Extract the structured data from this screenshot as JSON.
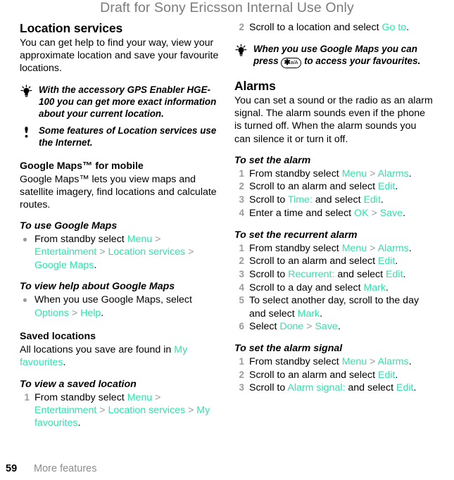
{
  "header": {
    "draft_notice": "Draft for Sony Ericsson Internal Use Only"
  },
  "colors": {
    "ui_accent": "#2ee3ac",
    "muted": "#9a9a9a",
    "draft_gray": "#7b7b7b"
  },
  "left_column": {
    "location_services": {
      "title": "Location services",
      "body": "You can get help to find your way, view your approximate location and save your favourite locations."
    },
    "tip_gps": {
      "icon": "lightbulb-icon",
      "text": "With the accessory GPS Enabler HGE-100 you can get more exact information about your current location."
    },
    "note_internet": {
      "icon": "exclamation-icon",
      "text": "Some features of Location services use the Internet."
    },
    "google_maps": {
      "title": "Google Maps™ for mobile",
      "body": "Google Maps™ lets you view maps and satellite imagery, find locations and calculate routes."
    },
    "to_use_google_maps": {
      "title": "To use Google Maps",
      "bullets": [
        {
          "pre": "From standby select ",
          "parts": [
            "Menu",
            "Entertainment",
            "Location services",
            "Google Maps"
          ],
          "post": "."
        }
      ]
    },
    "to_view_help": {
      "title": "To view help about Google Maps",
      "bullets": [
        {
          "pre": "When you use Google Maps, select ",
          "parts": [
            "Options",
            "Help"
          ],
          "post": "."
        }
      ]
    },
    "saved_locations": {
      "title": "Saved locations",
      "body_pre": "All locations you save are found in ",
      "body_ui": "My favourites",
      "body_post": "."
    },
    "to_view_saved_location": {
      "title": "To view a saved location",
      "steps": [
        {
          "num": "1",
          "pre": "From standby select ",
          "parts": [
            "Menu",
            "Entertainment",
            "Location services",
            "My favourites"
          ],
          "post": "."
        }
      ]
    }
  },
  "right_column": {
    "continued_step": {
      "num": "2",
      "pre": "Scroll to a location and select ",
      "ui": "Go to",
      "post": "."
    },
    "tip_favourites": {
      "icon": "lightbulb-icon",
      "pre": "When you use Google Maps you can press ",
      "key": {
        "star": "✱",
        "label": "a/A"
      },
      "post": " to access your favourites."
    },
    "alarms": {
      "title": "Alarms",
      "body": "You can set a sound or the radio as an alarm signal. The alarm sounds even if the phone is turned off. When the alarm sounds you can silence it or turn it off."
    },
    "to_set_the_alarm": {
      "title": "To set the alarm",
      "steps": [
        {
          "num": "1",
          "pre": "From standby select ",
          "ui1": "Menu",
          "sep": " > ",
          "ui2": "Alarms",
          "post": "."
        },
        {
          "num": "2",
          "pre": "Scroll to an alarm and select ",
          "ui1": "Edit",
          "post": "."
        },
        {
          "num": "3",
          "pre": "Scroll to ",
          "ui1": "Time:",
          "mid": " and select ",
          "ui2": "Edit",
          "post": "."
        },
        {
          "num": "4",
          "pre": "Enter a time and select ",
          "ui1": "OK",
          "sep": " > ",
          "ui2": "Save",
          "post": "."
        }
      ]
    },
    "to_set_the_recurrent_alarm": {
      "title": "To set the recurrent alarm",
      "steps": [
        {
          "num": "1",
          "pre": "From standby select ",
          "ui1": "Menu",
          "sep": " > ",
          "ui2": "Alarms",
          "post": "."
        },
        {
          "num": "2",
          "pre": "Scroll to an alarm and select ",
          "ui1": "Edit",
          "post": "."
        },
        {
          "num": "3",
          "pre": "Scroll to ",
          "ui1": "Recurrent:",
          "mid": " and select ",
          "ui2": "Edit",
          "post": "."
        },
        {
          "num": "4",
          "pre": "Scroll to a day and select ",
          "ui1": "Mark",
          "post": "."
        },
        {
          "num": "5",
          "pre": "To select another day, scroll to the day and select ",
          "ui1": "Mark",
          "post": "."
        },
        {
          "num": "6",
          "pre": "Select ",
          "ui1": "Done",
          "sep": " > ",
          "ui2": "Save",
          "post": "."
        }
      ]
    },
    "to_set_the_alarm_signal": {
      "title": "To set the alarm signal",
      "steps": [
        {
          "num": "1",
          "pre": "From standby select ",
          "ui1": "Menu",
          "sep": " > ",
          "ui2": "Alarms",
          "post": "."
        },
        {
          "num": "2",
          "pre": "Scroll to an alarm and select ",
          "ui1": "Edit",
          "post": "."
        },
        {
          "num": "3",
          "pre": "Scroll to ",
          "ui1": "Alarm signal:",
          "mid": " and select ",
          "ui2": "Edit",
          "post": "."
        }
      ]
    }
  },
  "footer": {
    "page_number": "59",
    "chapter": "More features"
  }
}
